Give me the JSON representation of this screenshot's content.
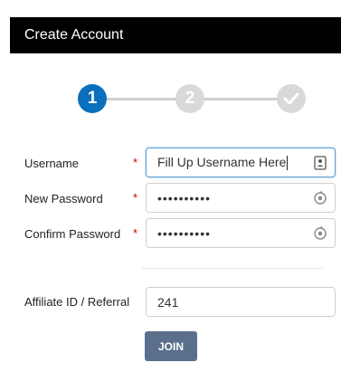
{
  "header": {
    "title": "Create Account"
  },
  "stepper": {
    "steps": [
      {
        "label": "1",
        "state": "active"
      },
      {
        "label": "2",
        "state": "inactive"
      },
      {
        "label": "",
        "state": "inactive",
        "icon": "check-icon"
      }
    ],
    "active_color": "#0a6fbd",
    "inactive_color": "#d9d9d9"
  },
  "form": {
    "required_mark": "*",
    "username": {
      "label": "Username",
      "value": "Fill Up Username Here",
      "icon": "contact-card-icon"
    },
    "new_password": {
      "label": "New Password",
      "masked_value": "••••••••••",
      "icon": "password-reveal-icon"
    },
    "confirm_password": {
      "label": "Confirm Password",
      "masked_value": "••••••••••",
      "icon": "password-reveal-icon"
    },
    "affiliate": {
      "label": "Affiliate ID / Referral",
      "value": "241"
    },
    "join_label": "JOIN"
  },
  "colors": {
    "header_bg": "#000000",
    "button_bg": "#5a6f8c",
    "required": "#cc0000"
  }
}
